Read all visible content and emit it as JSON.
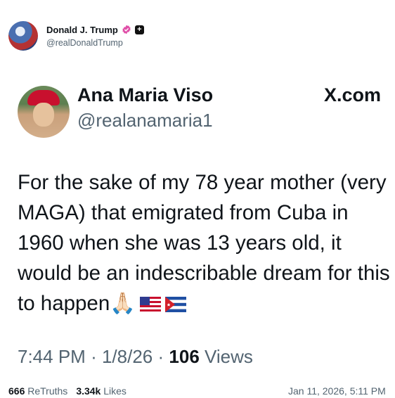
{
  "post": {
    "author_name": "Donald J. Trump",
    "author_handle": "@realDonaldTrump",
    "verified_icon": "verified-badge-icon",
    "plus_icon": "plus-badge-icon",
    "plus_glyph": "+"
  },
  "embed": {
    "name": "Ana Maria Viso",
    "handle": "@realanamaria1",
    "source": "X.com",
    "text": "For the sake of my 78 year mother (very MAGA) that emigrated from Cuba in 1960 when she was 13 years old, it would be an indescribable dream for this to happen🙏🏻",
    "time": "7:44 PM",
    "separator": "·",
    "date": "1/8/26",
    "views_count": "106",
    "views_label": "Views"
  },
  "stats": {
    "retruths_count": "666",
    "retruths_label": "ReTruths",
    "likes_count": "3.34k",
    "likes_label": "Likes",
    "timestamp": "Jan 11, 2026, 5:11 PM"
  }
}
